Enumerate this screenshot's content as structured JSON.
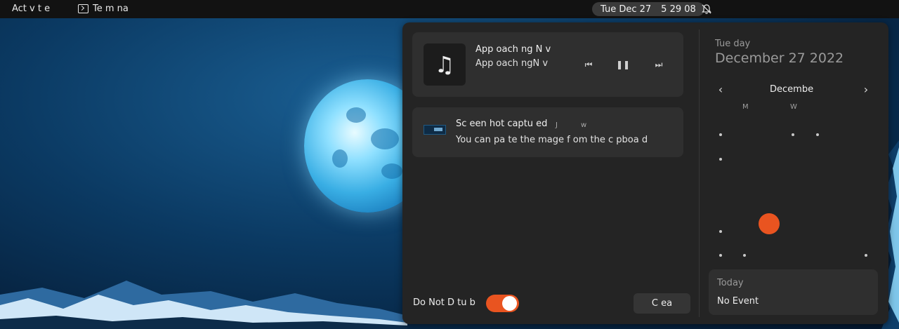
{
  "topbar": {
    "activities_label": "Act v t e",
    "app_name": "Te m na",
    "clock_date": "Tue Dec 27",
    "clock_time": "5 29 08"
  },
  "media": {
    "title": "App oach ng N  v",
    "artist": "App oach ngN  v",
    "icons": [
      "music-note-icon",
      "previous-icon",
      "pause-icon",
      "next-icon"
    ]
  },
  "notification": {
    "title": "Sc een  hot captu ed",
    "time_part1": "J",
    "time_part2": "w",
    "body": "You can pa te the  mage f om the c  pboa d"
  },
  "dnd": {
    "label": "Do Not D   tu b",
    "enabled": true
  },
  "clear_label": "C ea",
  "calendar": {
    "weekday": "Tue  day",
    "full_date": "December 27 2022",
    "month_label": "Decembe",
    "day_headers": [
      "M",
      "W"
    ],
    "accent_color": "#e95420"
  },
  "events": {
    "header": "Today",
    "body": "No Event"
  }
}
